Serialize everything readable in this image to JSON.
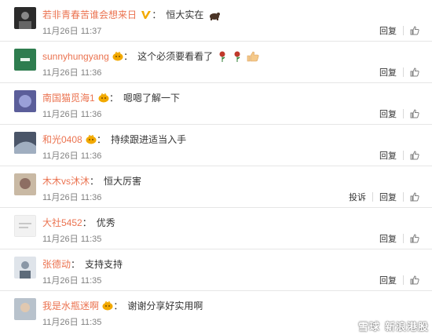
{
  "actions": {
    "reply": "回复",
    "report": "投诉"
  },
  "comments": [
    {
      "user": "若非青春苦谁会想来日",
      "text": "恒大实在",
      "time": "11月26日 11:37",
      "avatar_color": "#2b2b2b"
    },
    {
      "user": "sunnyhungyang",
      "text": "这个必须要看看了",
      "time": "11月26日 11:36",
      "avatar_color": "#2e7d4f"
    },
    {
      "user": "南国猫觅海1",
      "text": "嗯嗯了解一下",
      "time": "11月26日 11:36",
      "avatar_color": "#5b5e9a"
    },
    {
      "user": "和光0408",
      "text": "持续跟进适当入手",
      "time": "11月26日 11:36",
      "avatar_color": "#4a5568"
    },
    {
      "user": "木木vs沐沐",
      "text": "恒大厉害",
      "time": "11月26日 11:36",
      "avatar_color": "#c9b9a4"
    },
    {
      "user": "大社5452",
      "text": "优秀",
      "time": "11月26日 11:35",
      "avatar_color": "#e8e8e8"
    },
    {
      "user": "张德动",
      "text": "支持支持",
      "time": "11月26日 11:35",
      "avatar_color": "#8a97a6"
    },
    {
      "user": "我是水瓶迷啊",
      "text": "谢谢分享好实用啊",
      "time": "11月26日 11:35",
      "avatar_color": "#b8c2cc"
    }
  ],
  "watermark": {
    "brand": "雪球",
    "account": "新浪港股"
  },
  "colors": {
    "username": "#eb7350",
    "time": "#808080",
    "badge": "#f2a900"
  }
}
